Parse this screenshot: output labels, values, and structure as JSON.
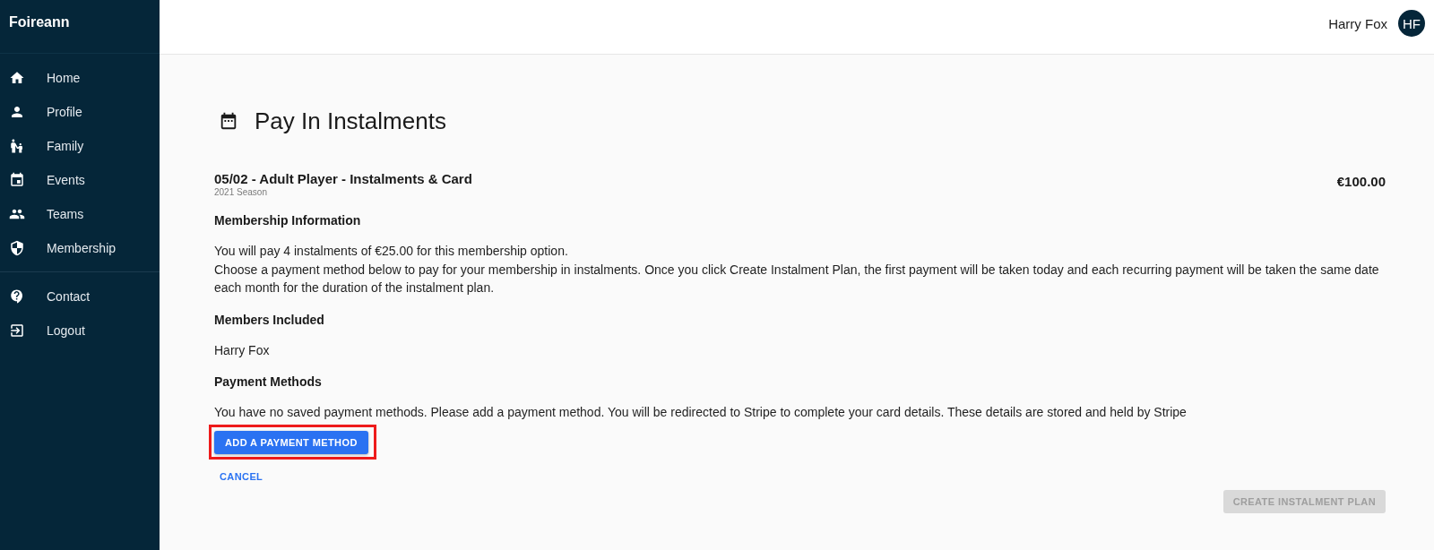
{
  "sidebar": {
    "brand": "Foireann",
    "main_nav": [
      "Home",
      "Profile",
      "Family",
      "Events",
      "Teams",
      "Membership"
    ],
    "secondary_nav": [
      "Contact",
      "Logout"
    ]
  },
  "header": {
    "user": {
      "name": "Harry Fox",
      "initials": "HF"
    }
  },
  "page": {
    "title": "Pay In Instalments"
  },
  "membership": {
    "title": "05/02 - Adult Player - Instalments & Card",
    "season": "2021 Season",
    "price": "€100.00"
  },
  "sections": [
    {
      "heading": "Membership Information",
      "lines": [
        "You will pay 4 instalments of €25.00 for this membership option.",
        "Choose a payment method below to pay for your membership in instalments. Once you click Create Instalment Plan, the first payment will be taken today and each recurring payment will be taken the same date each month for the duration of the instalment plan."
      ]
    },
    {
      "heading": "Members Included",
      "lines": [
        "Harry Fox"
      ]
    },
    {
      "heading": "Payment Methods",
      "lines": [
        "You have no saved payment methods. Please add a payment method. You will be redirected to Stripe to complete your card details. These details are stored and held by Stripe"
      ]
    }
  ],
  "actions": {
    "add_payment_method": {
      "label": "ADD A PAYMENT METHOD",
      "highlighted": true
    },
    "cancel": {
      "label": "CANCEL"
    },
    "create_plan": {
      "label": "CREATE INSTALMENT PLAN",
      "disabled": true
    }
  }
}
